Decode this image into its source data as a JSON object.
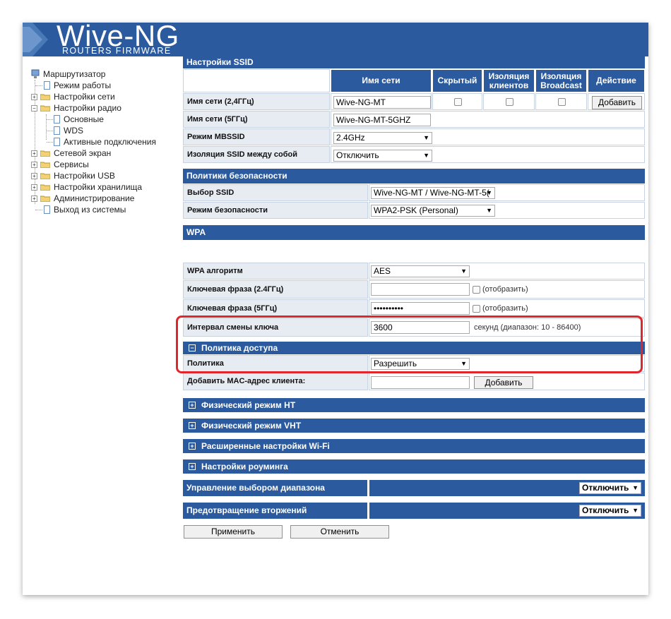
{
  "logo": {
    "title": "Wive-NG",
    "subtitle": "ROUTERS FIRMWARE"
  },
  "sidebar": {
    "root": "Маршрутизатор",
    "items": [
      "Режим работы",
      "Настройки сети",
      "Настройки радио",
      "Основные",
      "WDS",
      "Активные подключения",
      "Сетевой экран",
      "Сервисы",
      "Настройки USB",
      "Настройки хранилища",
      "Администрирование",
      "Выход из системы"
    ]
  },
  "ssid": {
    "header": "Настройки SSID",
    "cols": [
      "Имя сети",
      "Скрытый",
      "Изоляция клиентов",
      "Изоляция Broadcast",
      "Действие"
    ],
    "rows": [
      {
        "label": "Имя сети (2,4ГГц)",
        "value": "Wive-NG-MT",
        "action": "Добавить"
      },
      {
        "label": "Имя сети (5ГГц)",
        "value": "Wive-NG-MT-5GHZ"
      },
      {
        "label": "Режим MBSSID",
        "value": "2.4GHz"
      },
      {
        "label": "Изоляция SSID между собой",
        "value": "Отключить"
      }
    ]
  },
  "security": {
    "header": "Политики безопасности",
    "rows": [
      {
        "label": "Выбор SSID",
        "value": "Wive-NG-MT / Wive-NG-MT-5("
      },
      {
        "label": "Режим безопасности",
        "value": "WPA2-PSK (Personal)"
      }
    ]
  },
  "wpa": {
    "header": "WPA",
    "rows": [
      {
        "label": "WPA алгоритм",
        "value": "AES"
      },
      {
        "label": "Ключевая фраза (2.4ГГц)",
        "value": "",
        "hint": "(отобразить)"
      },
      {
        "label": "Ключевая фраза (5ГГц)",
        "value": "••••••••••",
        "hint": "(отобразить)"
      },
      {
        "label": "Интервал смены ключа",
        "value": "3600",
        "hint": "секунд (диапазон: 10 - 86400)"
      }
    ]
  },
  "access": {
    "header": "Политика доступа",
    "rows": [
      {
        "label": "Политика",
        "value": "Разрешить"
      },
      {
        "label": "Добавить MAC-адрес клиента:",
        "value": "",
        "button": "Добавить"
      }
    ]
  },
  "collapsed": [
    "Физический режим HT",
    "Физический режим VHT",
    "Расширенные настройки Wi-Fi",
    "Настройки роуминга"
  ],
  "band": {
    "label": "Управление выбором диапазона",
    "value": "Отключить"
  },
  "ids": {
    "label": "Предотвращение вторжений",
    "value": "Отключить"
  },
  "buttons": {
    "apply": "Применить",
    "cancel": "Отменить"
  },
  "colors": {
    "header_blue": "#2b5b9e",
    "highlight_red": "#e0262b",
    "label_bg": "#e7ebf2"
  }
}
